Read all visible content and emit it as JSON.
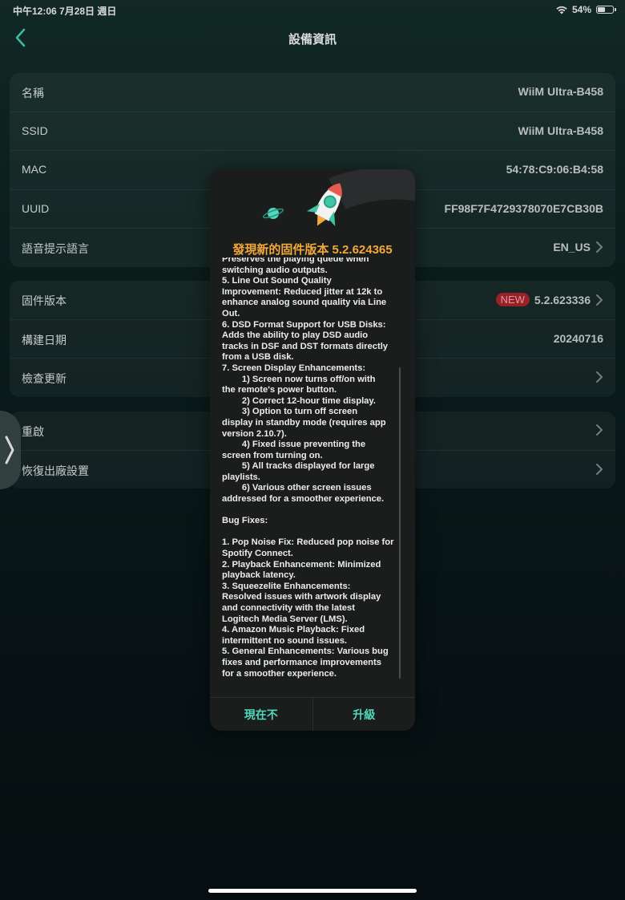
{
  "status": {
    "time_date": "中午12:06   7月28日 週日",
    "battery": "54%",
    "battery_level": 0.54
  },
  "nav": {
    "title": "設備資訊"
  },
  "info": [
    {
      "label": "名稱",
      "value": "WiiM Ultra-B458"
    },
    {
      "label": "SSID",
      "value": "WiiM Ultra-B458"
    },
    {
      "label": "MAC",
      "value": "54:78:C9:06:B4:58"
    },
    {
      "label": "UUID",
      "value": "FF98F7F4729378070E7CB30B"
    },
    {
      "label": "語音提示語言",
      "value": "EN_US"
    }
  ],
  "firmware": [
    {
      "label": "固件版本",
      "badge": "NEW",
      "value": "5.2.623336"
    },
    {
      "label": "構建日期",
      "value": "20240716"
    },
    {
      "label": "檢查更新"
    }
  ],
  "system": [
    {
      "label": "重啟"
    },
    {
      "label": "恢復出廠設置"
    }
  ],
  "modal": {
    "title": "發現新的固件版本 5.2.624365",
    "notes": "Preserves the playing queue when\nswitching audio outputs.\n5. Line Out Sound Quality\nImprovement: Reduced jitter at 12k to\nenhance analog sound quality via Line\nOut.\n6. DSD Format Support for USB Disks:\nAdds the ability to play DSD audio\ntracks in DSF and DST formats directly\nfrom a USB disk.\n7. Screen Display Enhancements:\n        1) Screen now turns off/on with\nthe remote's power button.\n        2) Correct 12-hour time display.\n        3) Option to turn off screen\ndisplay in standby mode (requires app\nversion 2.10.7).\n        4) Fixed issue preventing the\nscreen from turning on.\n        5) All tracks displayed for large\nplaylists.\n        6) Various other screen issues\naddressed for a smoother experience.\n\nBug Fixes:\n\n1. Pop Noise Fix: Reduced pop noise for\nSpotify Connect.\n2. Playback Enhancement: Minimized\nplayback latency.\n3. Squeezelite Enhancements:\nResolved issues with artwork display\nand connectivity with the latest\nLogitech Media Server (LMS).\n4. Amazon Music Playback: Fixed\nintermittent no sound issues.\n5. General Enhancements: Various bug\nfixes and performance improvements\nfor a smoother experience.",
    "cancel_label": "現在不",
    "confirm_label": "升級"
  },
  "colors": {
    "accent": "#4fd9bd",
    "title_orange": "#f2a83a",
    "badge_red": "#b3262e"
  }
}
